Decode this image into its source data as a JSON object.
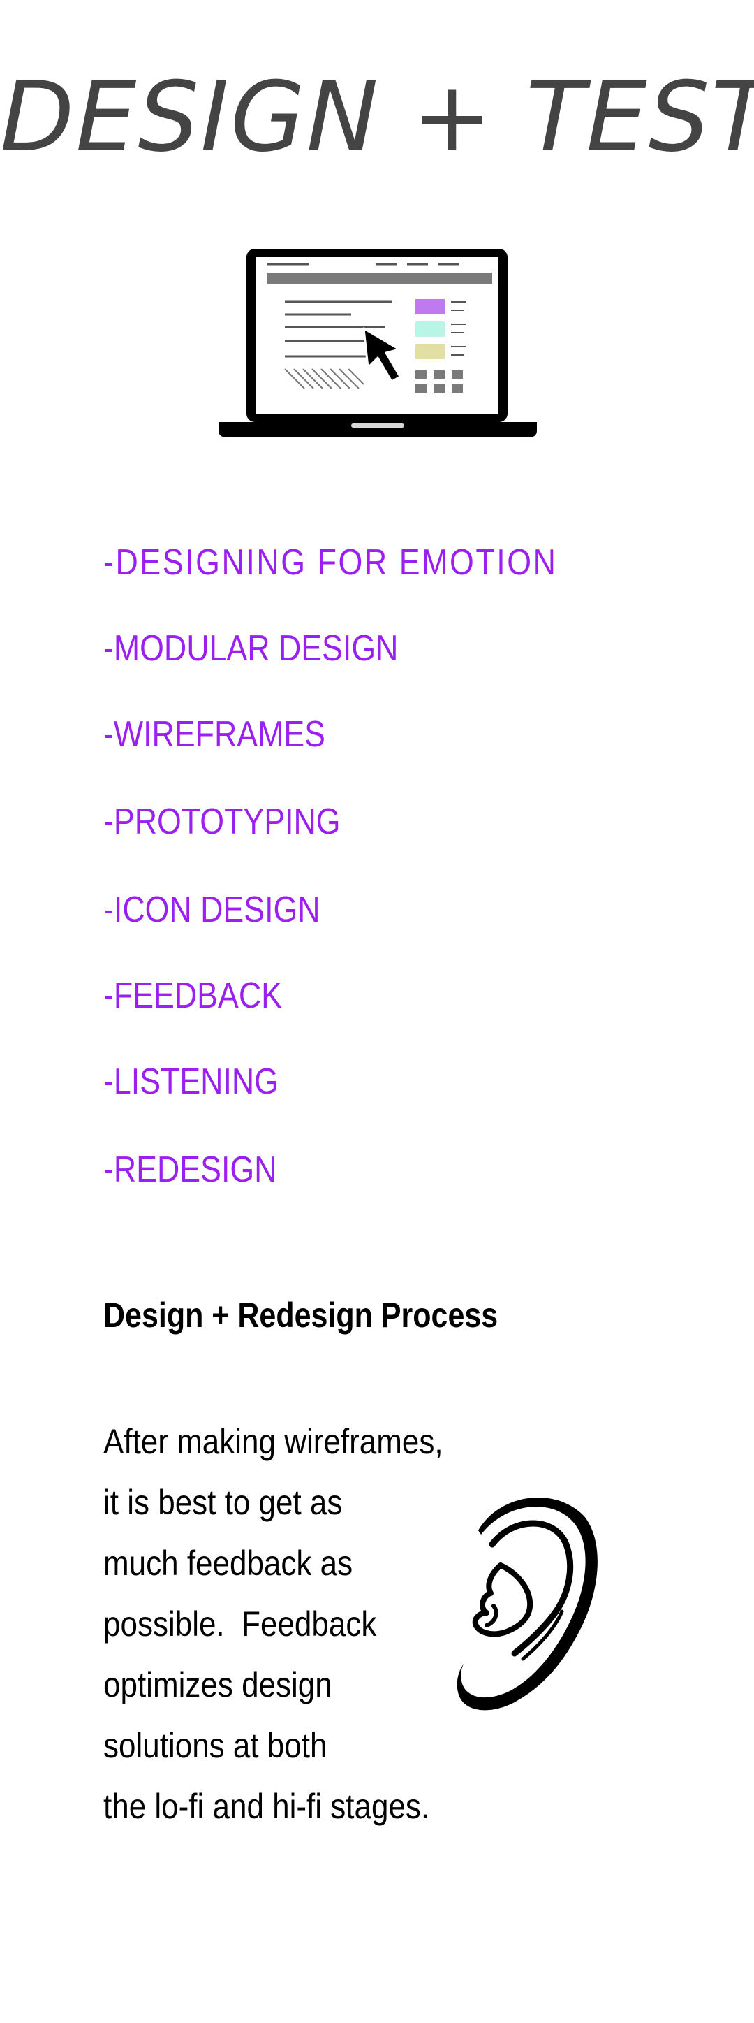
{
  "header": {
    "title": "DESIGN + TEST"
  },
  "illustrations": {
    "laptop": "laptop-wireframe-icon",
    "ear": "ear-icon"
  },
  "colors": {
    "topic_purple": "#9b1ff0",
    "title_gray": "#444444",
    "wire_purple": "#c07af0",
    "wire_mint": "#b8f5e6",
    "wire_khaki": "#e2dfa5"
  },
  "topics": [
    "-DESIGNING FOR EMOTION",
    "-MODULAR DESIGN",
    "-WIREFRAMES",
    "-PROTOTYPING",
    "-ICON DESIGN",
    "-FEEDBACK",
    "-LISTENING",
    "-REDESIGN"
  ],
  "section": {
    "heading": "Design + Redesign Process",
    "body_lines": [
      "After making wireframes,",
      "it is best to get as",
      "much feedback as",
      "possible.  Feedback",
      "optimizes design",
      "solutions at both",
      "the lo-fi and hi-fi stages."
    ]
  }
}
